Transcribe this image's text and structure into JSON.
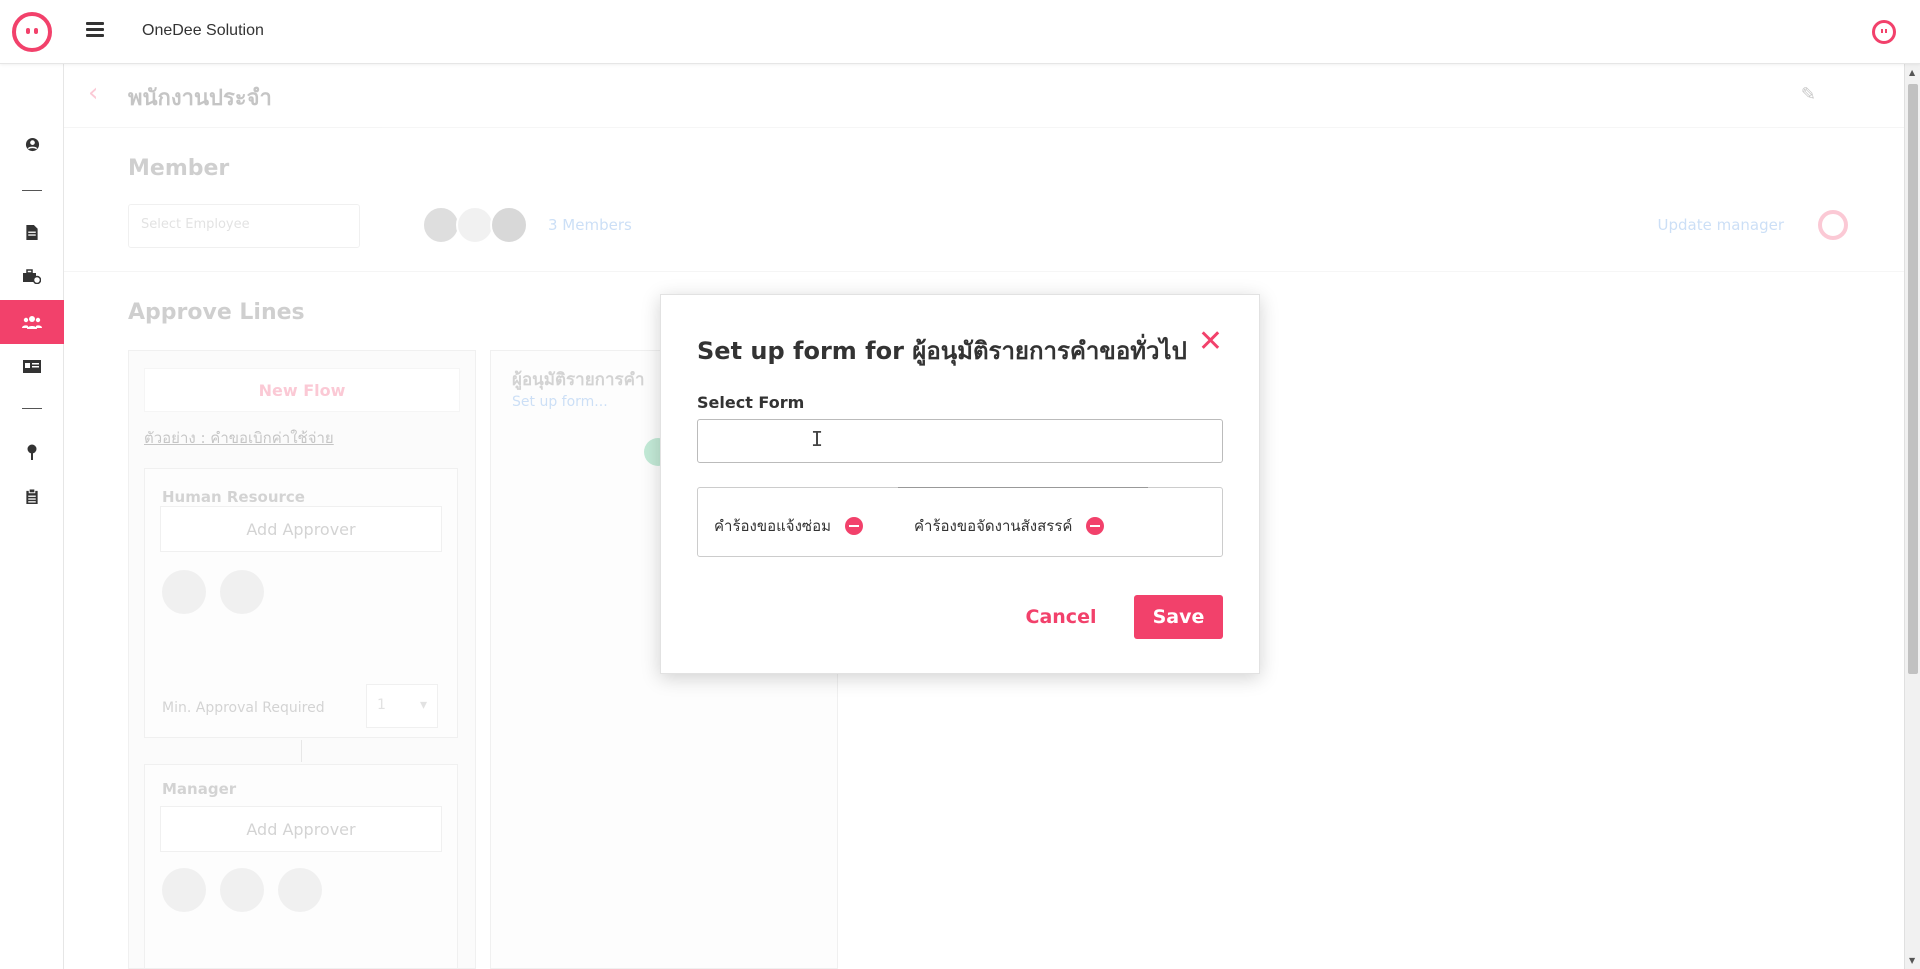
{
  "topbar": {
    "company_name": "OneDee Solution"
  },
  "sidebar": {
    "items": [
      {
        "icon": "user-circle-icon"
      },
      {
        "icon": "document-icon"
      },
      {
        "icon": "briefcase-clock-icon"
      },
      {
        "icon": "users-icon",
        "active": true
      },
      {
        "icon": "id-card-icon"
      },
      {
        "icon": "map-pin-icon"
      },
      {
        "icon": "clipboard-icon"
      }
    ]
  },
  "page": {
    "title": "พนักงานประจำ",
    "member_heading": "Member",
    "select_employee_placeholder": "Select Employee",
    "members_count": "3 Members",
    "update_manager": "Update manager",
    "approve_lines_heading": "Approve Lines",
    "new_flow": "New Flow",
    "example_link": "ตัวอย่าง : คำขอเบิกค่าใช้จ่าย",
    "hr_title": "Human Resource",
    "add_approver": "Add Approver",
    "min_approval_label": "Min. Approval Required",
    "min_approval_value": "1",
    "manager_title": "Manager",
    "detail_title": "ผู้อนุมัติรายการคำ",
    "setup_link": "Set up form..."
  },
  "modal": {
    "title": "Set up form for ผู้อนุมัติรายการคำขอทั่วไป",
    "select_label": "Select Form",
    "select_value": "",
    "tags": [
      {
        "label": "คำร้องขอแจ้งซ่อม"
      },
      {
        "label": "คำร้องขอจัดงานสังสรรค์"
      }
    ],
    "cancel_label": "Cancel",
    "save_label": "Save"
  },
  "colors": {
    "accent": "#f2416b",
    "link": "#4a90e2",
    "success": "#2bb673"
  }
}
